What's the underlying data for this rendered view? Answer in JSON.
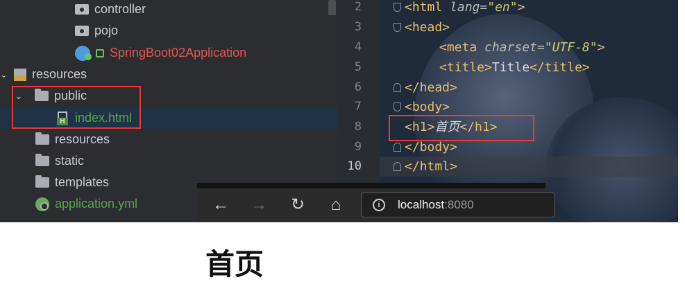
{
  "project_tree": {
    "items": [
      {
        "label": "controller",
        "icon": "folder-package-icon"
      },
      {
        "label": "pojo",
        "icon": "folder-package-icon"
      },
      {
        "label": "SpringBoot02Application",
        "icon": "spring-boot-class-icon"
      },
      {
        "label": "resources",
        "icon": "resources-folder-icon"
      },
      {
        "label": "public",
        "icon": "folder-icon"
      },
      {
        "label": "index.html",
        "icon": "html-file-icon"
      },
      {
        "label": "resources",
        "icon": "folder-icon"
      },
      {
        "label": "static",
        "icon": "folder-icon"
      },
      {
        "label": "templates",
        "icon": "folder-icon"
      },
      {
        "label": "application.yml",
        "icon": "yml-file-icon"
      }
    ]
  },
  "editor": {
    "line_numbers": [
      "2",
      "3",
      "4",
      "5",
      "6",
      "7",
      "8",
      "9",
      "10"
    ],
    "current_line": "10",
    "lines": [
      {
        "open": "<html ",
        "attr": "lang",
        "eq": "=",
        "val": "\"en\"",
        "close": ">"
      },
      {
        "code": "<head>"
      },
      {
        "open": "<meta ",
        "attr": "charset",
        "eq": "=",
        "val": "\"UTF-8\"",
        "close": ">"
      },
      {
        "open_tag": "<title>",
        "text": "Title",
        "close_tag": "</title>"
      },
      {
        "code": "</head>"
      },
      {
        "code": "<body>"
      },
      {
        "open_tag": "<h1>",
        "text": "首页",
        "close_tag": "</h1>"
      },
      {
        "code": "</body>"
      },
      {
        "code": "</html>"
      }
    ]
  },
  "browser": {
    "back": "←",
    "forward": "→",
    "refresh": "↻",
    "home": "⌂",
    "url_host": "localhost",
    "url_port": ":8080"
  },
  "rendered_page": {
    "heading": "首页"
  },
  "colors": {
    "highlight_box": "#e83a3a",
    "tree_background": "#2b2d30",
    "tag_color": "#e8bf6a"
  }
}
